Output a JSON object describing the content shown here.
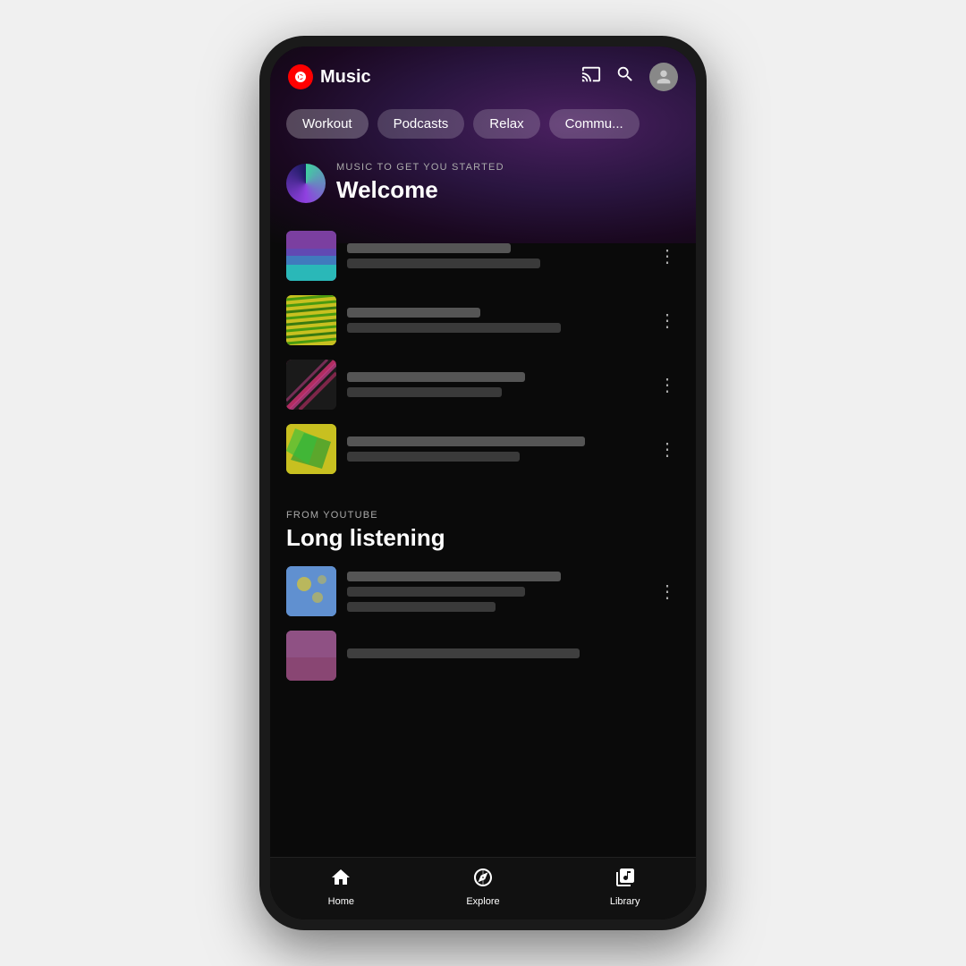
{
  "app": {
    "name": "Music",
    "logo_label": "YT Music Logo"
  },
  "header": {
    "cast_label": "Cast",
    "search_label": "Search",
    "account_label": "Account"
  },
  "tabs": [
    {
      "id": "workout",
      "label": "Workout",
      "active": true
    },
    {
      "id": "podcasts",
      "label": "Podcasts",
      "active": false
    },
    {
      "id": "relax",
      "label": "Relax",
      "active": false
    },
    {
      "id": "community",
      "label": "Commu...",
      "active": false
    }
  ],
  "sections": [
    {
      "id": "welcome",
      "label": "MUSIC TO GET YOU STARTED",
      "title": "Welcome",
      "tracks": [
        {
          "id": "t1",
          "line1_width": "55%",
          "line2_width": "65%"
        },
        {
          "id": "t2",
          "line1_width": "45%",
          "line2_width": "72%"
        },
        {
          "id": "t3",
          "line1_width": "60%",
          "line2_width": "52%"
        },
        {
          "id": "t4",
          "line1_width": "80%",
          "line2_width": "58%"
        }
      ]
    },
    {
      "id": "long-listening",
      "label": "FROM YOUTUBE",
      "title": "Long listening",
      "tracks": [
        {
          "id": "t5",
          "line1_width": "72%",
          "line2_width": "60%",
          "line3_width": "50%"
        },
        {
          "id": "t6",
          "line1_width": "70%",
          "line2_width": "55%"
        }
      ]
    }
  ],
  "bottom_nav": [
    {
      "id": "home",
      "label": "Home",
      "icon": "🏠"
    },
    {
      "id": "explore",
      "label": "Explore",
      "icon": "🧭"
    },
    {
      "id": "library",
      "label": "Library",
      "icon": "🎵"
    }
  ]
}
